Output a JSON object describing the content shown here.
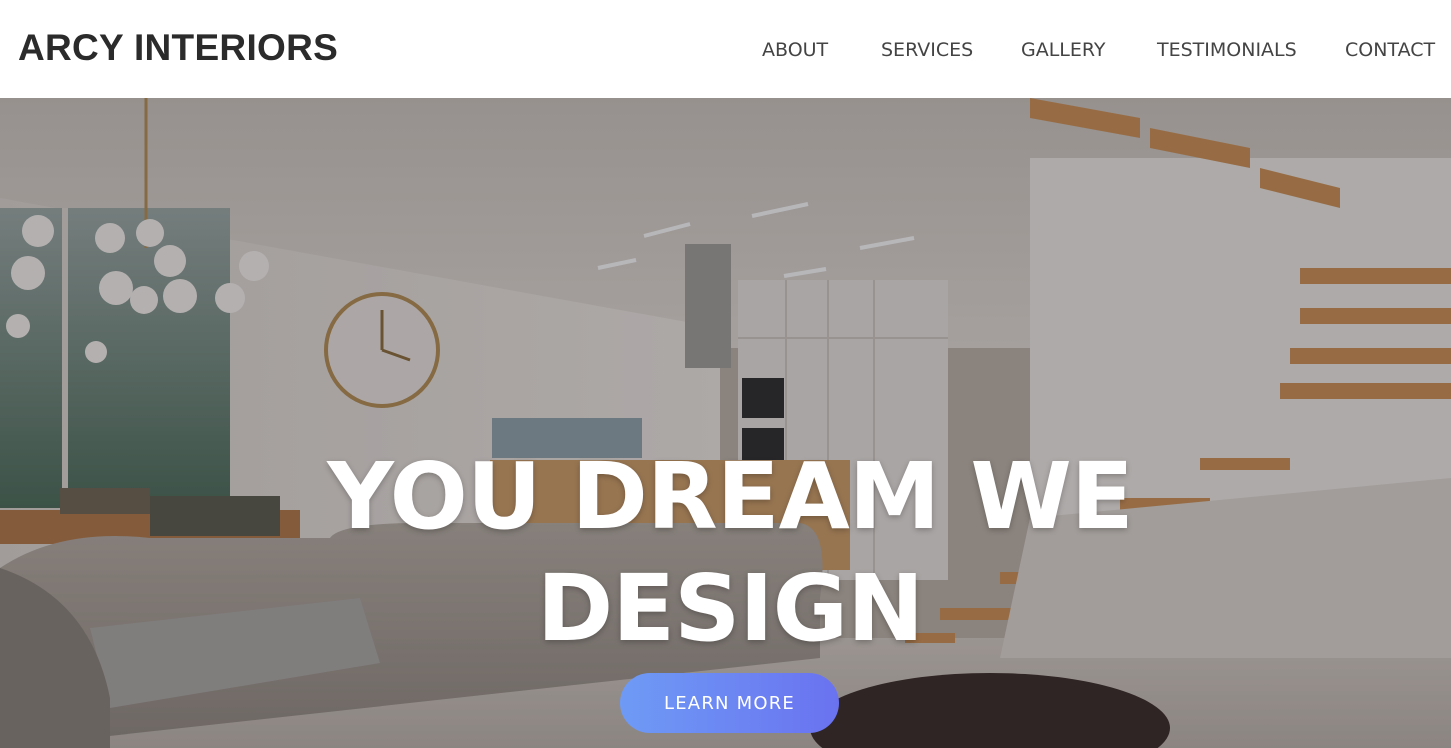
{
  "brand": {
    "name": "ARCY INTERIORS"
  },
  "nav": {
    "items": [
      {
        "label": "ABOUT"
      },
      {
        "label": "SERVICES"
      },
      {
        "label": "GALLERY"
      },
      {
        "label": "TESTIMONIALS"
      },
      {
        "label": "CONTACT"
      }
    ]
  },
  "hero": {
    "headline_line1": "YOU DREAM WE",
    "headline_line2": "DESIGN",
    "cta_label": "LEARN MORE",
    "background": "interior-photo-living-room-kitchen-staircase"
  },
  "colors": {
    "nav_bg": "#ffffff",
    "brand_text": "#2b2b2b",
    "nav_text": "#444444",
    "cta_start": "#6e9bf5",
    "cta_end": "#6a72f0",
    "headline": "#ffffff"
  }
}
